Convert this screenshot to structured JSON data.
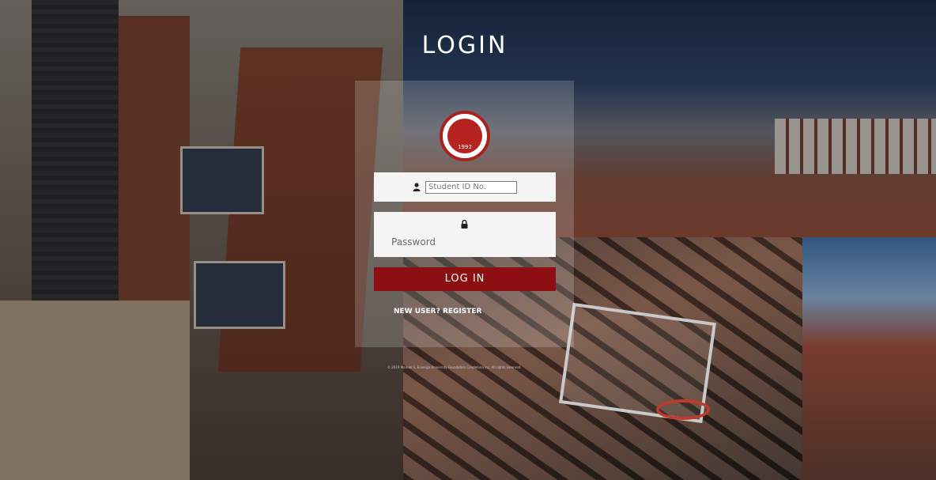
{
  "page": {
    "title": "LOGIN",
    "accent_color": "#8e0f12"
  },
  "form": {
    "student_id_placeholder": "Student ID No.",
    "password_placeholder": "Password",
    "user_icon": "user-icon",
    "lock_icon": "lock-icon",
    "submit_label": "LOG IN",
    "register_link": "NEW USER? REGISTER"
  },
  "seal": {
    "year": "1992"
  },
  "footer": {
    "copyright": "© 2019 Manuel S. Enverga University Foundation Candelaria Inc. All rights reserved."
  }
}
